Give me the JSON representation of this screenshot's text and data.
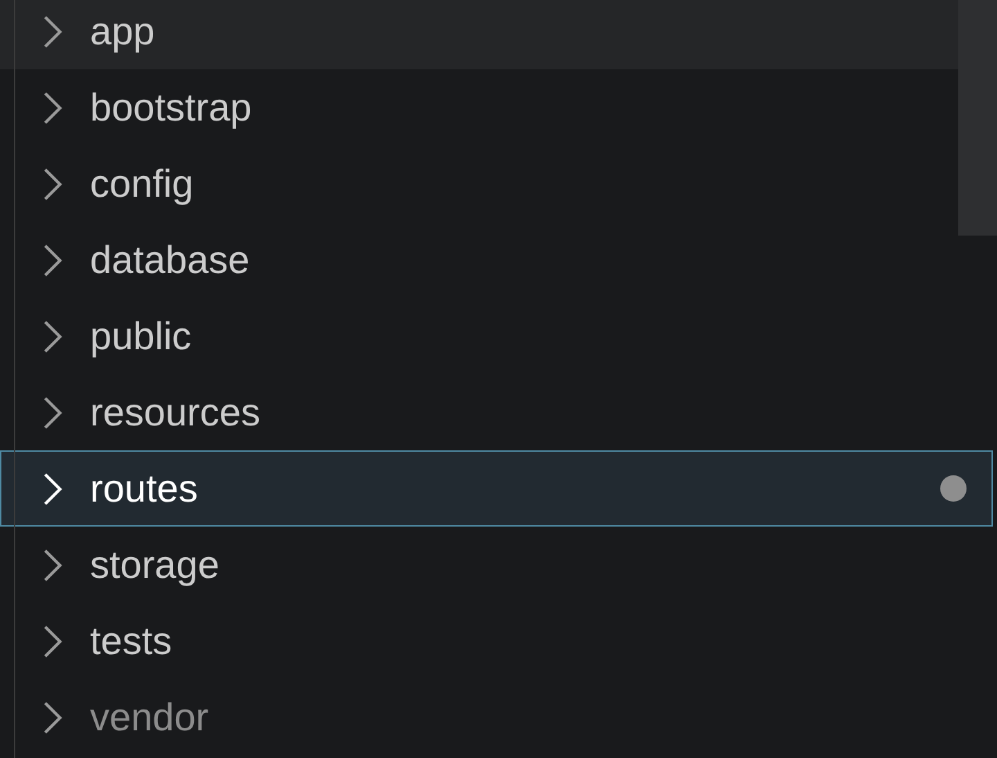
{
  "explorer": {
    "items": [
      {
        "label": "app",
        "hovered": true,
        "selected": false,
        "modified": false,
        "ignored": false
      },
      {
        "label": "bootstrap",
        "hovered": false,
        "selected": false,
        "modified": false,
        "ignored": false
      },
      {
        "label": "config",
        "hovered": false,
        "selected": false,
        "modified": false,
        "ignored": false
      },
      {
        "label": "database",
        "hovered": false,
        "selected": false,
        "modified": false,
        "ignored": false
      },
      {
        "label": "public",
        "hovered": false,
        "selected": false,
        "modified": false,
        "ignored": false
      },
      {
        "label": "resources",
        "hovered": false,
        "selected": false,
        "modified": false,
        "ignored": false
      },
      {
        "label": "routes",
        "hovered": false,
        "selected": true,
        "modified": true,
        "ignored": false
      },
      {
        "label": "storage",
        "hovered": false,
        "selected": false,
        "modified": false,
        "ignored": false
      },
      {
        "label": "tests",
        "hovered": false,
        "selected": false,
        "modified": false,
        "ignored": false
      },
      {
        "label": "vendor",
        "hovered": false,
        "selected": false,
        "modified": false,
        "ignored": true
      }
    ]
  }
}
